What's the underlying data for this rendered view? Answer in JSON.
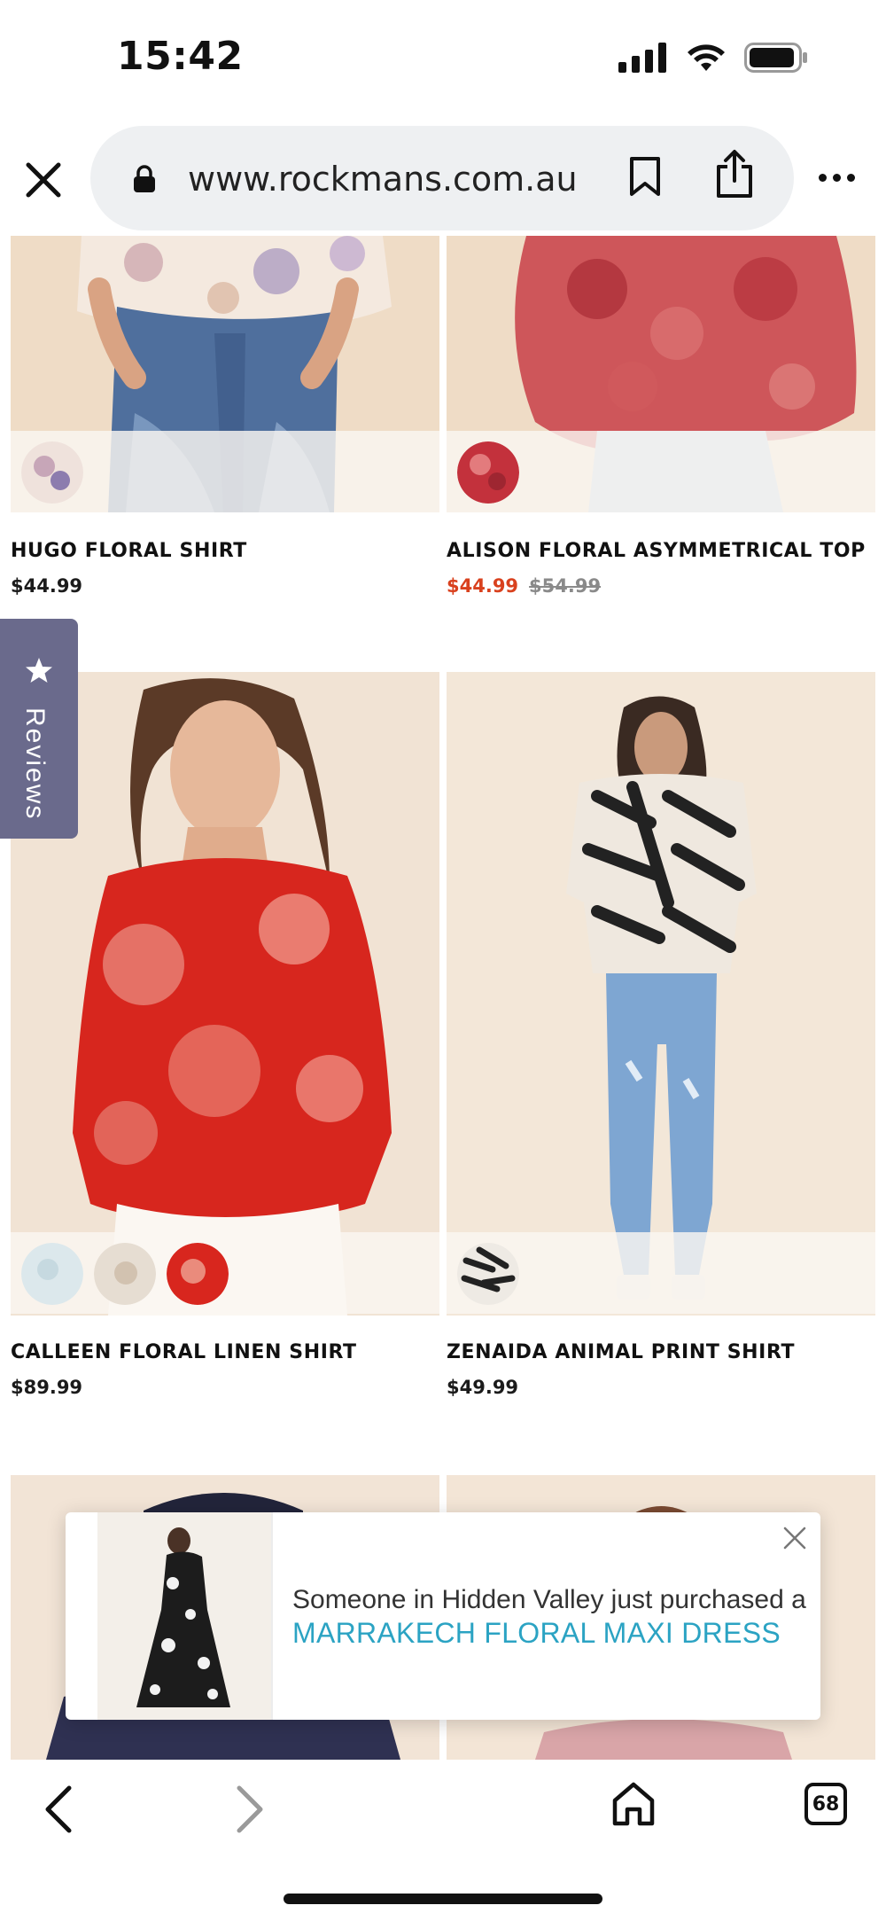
{
  "status_bar": {
    "time": "15:42"
  },
  "browser": {
    "url": "www.rockmans.com.au",
    "tab_count": "68"
  },
  "products": [
    {
      "name": "HUGO FLORAL SHIRT",
      "price": "$44.99",
      "was_price": ""
    },
    {
      "name": "ALISON FLORAL ASYMMETRICAL TOP",
      "price": "$44.99",
      "was_price": "$54.99"
    },
    {
      "name": "CALLEEN FLORAL LINEN SHIRT",
      "price": "$89.99",
      "was_price": ""
    },
    {
      "name": "ZENAIDA ANIMAL PRINT SHIRT",
      "price": "$49.99",
      "was_price": ""
    }
  ],
  "reviews_tab": {
    "label": "Reviews"
  },
  "popup": {
    "text": "Someone in Hidden Valley just purchased a",
    "product_link": "MARRAKECH FLORAL MAXI DRESS"
  },
  "colors": {
    "sale_price": "#d9411e",
    "reviews_tab": "#6a6a8c",
    "popup_link": "#2ba3c3",
    "url_bar": "#eef0f2"
  }
}
